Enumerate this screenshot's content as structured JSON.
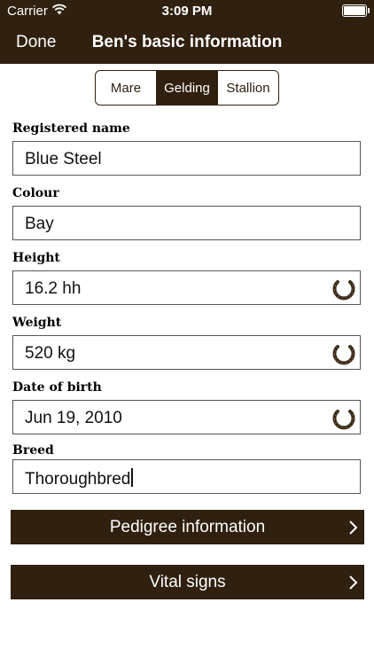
{
  "status": {
    "carrier": "Carrier",
    "time": "3:09 PM"
  },
  "nav": {
    "done_label": "Done",
    "title": "Ben's basic information"
  },
  "sex_segment": {
    "options": [
      "Mare",
      "Gelding",
      "Stallion"
    ],
    "selected": "Gelding"
  },
  "form": {
    "registered_name": {
      "label": "Registered name",
      "value": "Blue Steel"
    },
    "colour": {
      "label": "Colour",
      "value": "Bay"
    },
    "height": {
      "label": "Height",
      "value": "16.2 hh"
    },
    "weight": {
      "label": "Weight",
      "value": "520 kg"
    },
    "date_of_birth": {
      "label": "Date of birth",
      "value": "Jun 19, 2010"
    },
    "breed": {
      "label": "Breed",
      "value": "Thoroughbred"
    }
  },
  "buttons": {
    "pedigree": "Pedigree information",
    "vital_signs": "Vital signs"
  },
  "icons": {
    "picker": "horseshoe-icon",
    "disclosure": "chevron-right-icon"
  },
  "colors": {
    "accent": "#30200f"
  }
}
